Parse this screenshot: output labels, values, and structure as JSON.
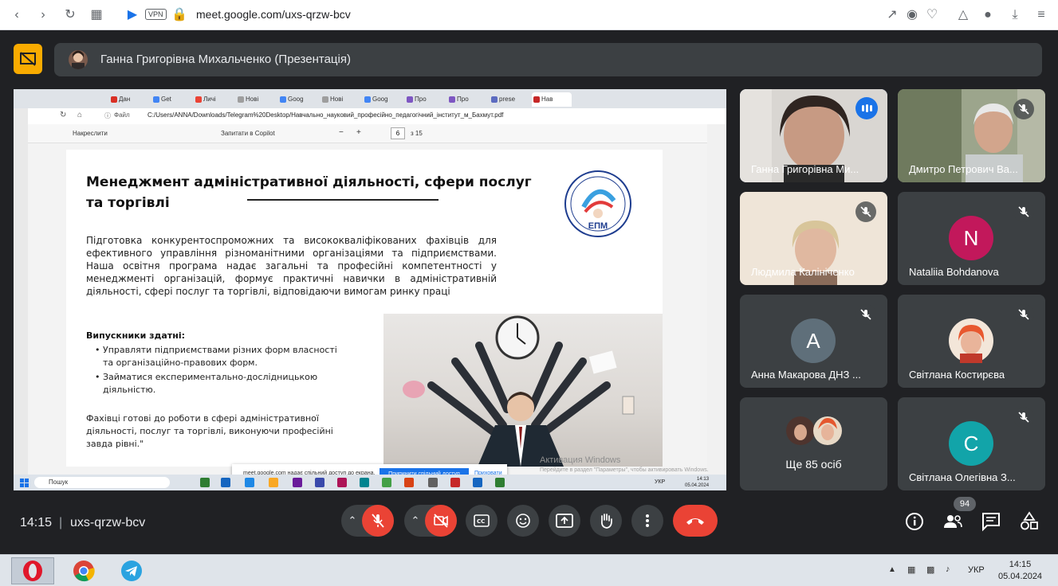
{
  "browser": {
    "url": "meet.google.com/uxs-qrzw-bcv",
    "vpn_label": "VPN"
  },
  "presentation_bar": {
    "presenter": "Ганна Григорівна Михальченко (Презентація)"
  },
  "shared_screen": {
    "file_label": "Файл",
    "path": "C:/Users/ANNA/Downloads/Telegram%20Desktop/Навчально_науковий_професійно_педагогічний_інститут_м_Бахмут.pdf",
    "toolbar": {
      "draw": "Накреслити",
      "ask_copilot": "Запитати в Copilot",
      "page": "6",
      "of_pages": "з 15"
    },
    "tabs": [
      "Дан",
      "Get",
      "Личі",
      "Нові",
      "Goog",
      "Нові",
      "Goog",
      "Про",
      "Про",
      "prese",
      "Нав"
    ],
    "slide": {
      "title": "Менеджмент адміністративної діяльності, сфери послуг та торгівлі",
      "body": "Підготовка конкурентоспроможних та висококваліфікованих фахівців для ефективного управління різноманітними організаціями та підприємствами. Наша освітня програма надає загальні та професійні компетентності у менеджменті організацій, формує практичні навички в адміністративній діяльності, сфері послуг та торгівлі, відповідаючи вимогам ринку праці",
      "graduates_heading": "Випускники здатні:",
      "graduates_list": [
        "Управляти підприємствами різних форм власності та організаційно-правових форм.",
        "Займатися експериментально-дослідницькою діяльністю."
      ],
      "footer": "Фахівці готові до роботи в сфері адміністративної діяльності, послуг та торгівлі, виконуючи професійні завда рівні.\"",
      "logo_text": "ЕПМ",
      "watermark": "Активация Windows",
      "watermark_sub": "Перейдите в раздел \"Параметры\", чтобы активировать Windows."
    },
    "share_popup": {
      "message": "meet.google.com надає спільний доступ до екрана.",
      "stop": "Припинити спільний доступ",
      "hide": "Приховати"
    },
    "taskbar": {
      "search": "Пошук",
      "lang": "УКР",
      "time": "14:13",
      "date": "05.04.2024"
    }
  },
  "participants": [
    {
      "name": "Ганна Григорівна Ми...",
      "speaking": true
    },
    {
      "name": "Дмитро Петрович Ва...",
      "muted": true
    },
    {
      "name": "Людмила Калініченко",
      "muted": true
    },
    {
      "name": "Nataliia Bohdanova",
      "letter": "N",
      "color": "#c2185b",
      "muted": true
    },
    {
      "name": "Анна Макарова ДНЗ ...",
      "letter": "A",
      "color": "#5f6f7a",
      "muted": true
    },
    {
      "name": "Світлана Костирєва",
      "muted": true
    },
    {
      "name": "Ще 85 осіб"
    },
    {
      "name": "Світлана Олегівна З...",
      "letter": "C",
      "color": "#12a4a9",
      "muted": true
    }
  ],
  "bottom": {
    "time": "14:15",
    "separator": "|",
    "meeting_code": "uxs-qrzw-bcv",
    "participant_count": "94"
  },
  "os_taskbar": {
    "lang": "УКР",
    "time": "14:15",
    "date": "05.04.2024"
  }
}
